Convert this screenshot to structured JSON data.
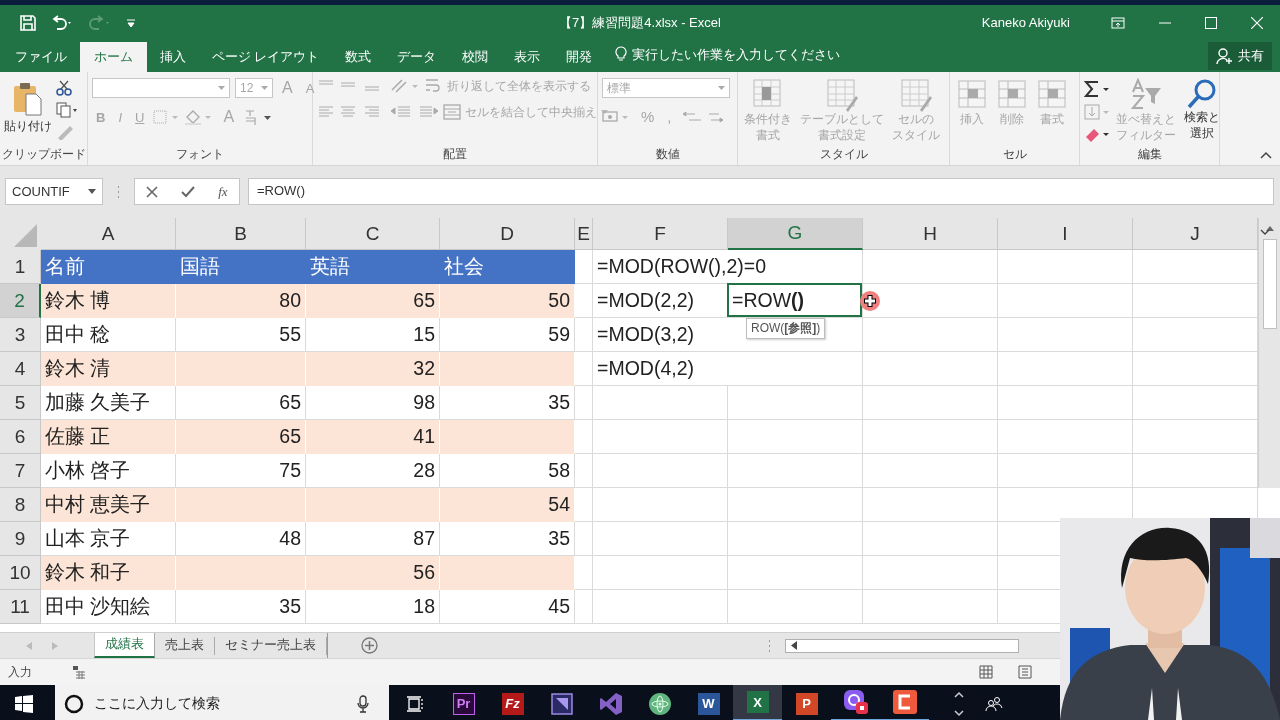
{
  "title_bar": {
    "title": "【7】練習問題4.xlsx  -  Excel",
    "user": "Kaneko Akiyuki"
  },
  "ribbon_tabs": [
    {
      "label": "ファイル",
      "selected": false
    },
    {
      "label": "ホーム",
      "selected": true
    },
    {
      "label": "挿入",
      "selected": false
    },
    {
      "label": "ページ レイアウト",
      "selected": false
    },
    {
      "label": "数式",
      "selected": false
    },
    {
      "label": "データ",
      "selected": false
    },
    {
      "label": "校閲",
      "selected": false
    },
    {
      "label": "表示",
      "selected": false
    },
    {
      "label": "開発",
      "selected": false
    }
  ],
  "tell_me": "実行したい作業を入力してください",
  "share": "共有",
  "ribbon": {
    "groups": [
      {
        "kind": "clipboard",
        "label": "クリップボード",
        "disabled": false,
        "paste": "貼り付け"
      },
      {
        "kind": "font",
        "label": "フォント",
        "disabled": true,
        "font_size": "12",
        "grow": "A",
        "shrink": "A",
        "bold": "B",
        "italic": "I",
        "underline": "U",
        "font_color": "A"
      },
      {
        "kind": "alignment",
        "label": "配置",
        "disabled": true,
        "wrap": "折り返して全体を表示する",
        "merge": "セルを結合して中央揃え"
      },
      {
        "kind": "number",
        "label": "数値",
        "disabled": true,
        "format": "標準",
        "percent": "%",
        "comma": ","
      },
      {
        "kind": "styles",
        "label": "スタイル",
        "disabled": true,
        "buttons": [
          {
            "lines": [
              "条件付き",
              "書式"
            ]
          },
          {
            "lines": [
              "テーブルとして",
              "書式設定"
            ]
          },
          {
            "lines": [
              "セルの",
              "スタイル"
            ]
          }
        ]
      },
      {
        "kind": "cells",
        "label": "セル",
        "disabled": true,
        "buttons": [
          "挿入",
          "削除",
          "書式"
        ]
      },
      {
        "kind": "editing",
        "label": "編集",
        "disabled": false,
        "sort": {
          "lines": [
            "並べ替えと",
            "フィルター"
          ],
          "disabled": true
        },
        "find": {
          "lines": [
            "検索と",
            "選択"
          ],
          "disabled": false
        }
      }
    ]
  },
  "formula_bar": {
    "name_box": "COUNTIF",
    "fx": "fx",
    "formula": "=ROW()"
  },
  "columns": [
    {
      "label": "A",
      "selected": false
    },
    {
      "label": "B",
      "selected": false
    },
    {
      "label": "C",
      "selected": false
    },
    {
      "label": "D",
      "selected": false
    },
    {
      "label": "E",
      "selected": false
    },
    {
      "label": "F",
      "selected": false
    },
    {
      "label": "G",
      "selected": true
    },
    {
      "label": "H",
      "selected": false
    },
    {
      "label": "I",
      "selected": false
    },
    {
      "label": "J",
      "selected": false
    }
  ],
  "rows": [
    {
      "header": "1",
      "kind": "header",
      "selected": false,
      "cells": [
        "名前",
        "国語",
        "英語",
        "社会",
        null,
        "=MOD(ROW(),2)=0"
      ]
    },
    {
      "header": "2",
      "kind": "data",
      "shaded": true,
      "selected": true,
      "cells": [
        "鈴木 博",
        "80",
        "65",
        "50",
        null,
        "=MOD(2,2)",
        {
          "text": "=ROW**()**",
          "editing": true,
          "tooltip": "ROW(**[参照]**)"
        }
      ]
    },
    {
      "header": "3",
      "kind": "data",
      "shaded": false,
      "selected": false,
      "cells": [
        "田中 稔",
        "55",
        "15",
        "59",
        null,
        "=MOD(3,2)"
      ]
    },
    {
      "header": "4",
      "kind": "data",
      "shaded": true,
      "selected": false,
      "cells": [
        "鈴木 清",
        null,
        "32",
        null,
        null,
        "=MOD(4,2)"
      ]
    },
    {
      "header": "5",
      "kind": "data",
      "shaded": false,
      "selected": false,
      "cells": [
        "加藤 久美子",
        "65",
        "98",
        "35"
      ]
    },
    {
      "header": "6",
      "kind": "data",
      "shaded": true,
      "selected": false,
      "cells": [
        "佐藤 正",
        "65",
        "41",
        null
      ]
    },
    {
      "header": "7",
      "kind": "data",
      "shaded": false,
      "selected": false,
      "cells": [
        "小林 啓子",
        "75",
        "28",
        "58"
      ]
    },
    {
      "header": "8",
      "kind": "data",
      "shaded": true,
      "selected": false,
      "cells": [
        "中村 恵美子",
        null,
        null,
        "54"
      ]
    },
    {
      "header": "9",
      "kind": "data",
      "shaded": false,
      "selected": false,
      "cells": [
        "山本 京子",
        "48",
        "87",
        "35"
      ]
    },
    {
      "header": "10",
      "kind": "data",
      "shaded": true,
      "selected": false,
      "cells": [
        "鈴木 和子",
        null,
        "56",
        null
      ]
    },
    {
      "header": "11",
      "kind": "data",
      "shaded": false,
      "selected": false,
      "cells": [
        "田中 沙知絵",
        "35",
        "18",
        "45"
      ]
    }
  ],
  "sheet_tabs": [
    {
      "label": "成績表",
      "selected": true
    },
    {
      "label": "売上表",
      "selected": false
    },
    {
      "label": "セミナー売上表",
      "selected": false
    }
  ],
  "status_bar": {
    "mode": "入力"
  },
  "taskbar": {
    "search": "ここに入力して検索",
    "apps": [
      {
        "kind": "premiere",
        "label": "Pr",
        "running": false
      },
      {
        "kind": "filezilla",
        "label": "Fz",
        "running": false
      },
      {
        "kind": "media",
        "running": false
      },
      {
        "kind": "visualstudio",
        "running": false
      },
      {
        "kind": "atom",
        "running": false
      },
      {
        "kind": "word",
        "label": "W",
        "running": false
      },
      {
        "kind": "excel",
        "label": "X",
        "running": true
      },
      {
        "kind": "powerpoint",
        "label": "P",
        "running": false
      },
      {
        "kind": "recorder",
        "running": true
      },
      {
        "kind": "camtasia",
        "running": true
      }
    ]
  }
}
